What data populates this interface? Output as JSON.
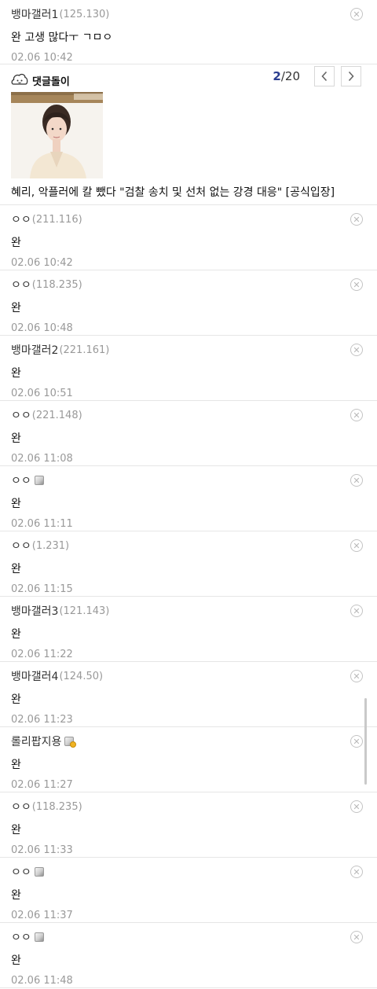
{
  "top_comment": {
    "nick": "뱅마갤러1",
    "ip": "(125.130)",
    "text": "완 고생 많다ㅜ ㄱㅁㅇ",
    "date": "02.06 10:42"
  },
  "promo": {
    "label": "댓글돌이",
    "page_current": "2",
    "page_total": "/20",
    "headline": "혜리, 악플러에 칼 뺐다 \"검찰 송치 및 선처 없는 강경 대응\" [공식입장]"
  },
  "comments": [
    {
      "nick": "ㅇㅇ",
      "ip": "(211.116)",
      "text": "완",
      "date": "02.06 10:42"
    },
    {
      "nick": "ㅇㅇ",
      "ip": "(118.235)",
      "text": "완",
      "date": "02.06 10:48"
    },
    {
      "nick": "뱅마갤러2",
      "ip": "(221.161)",
      "text": "완",
      "date": "02.06 10:51"
    },
    {
      "nick": "ㅇㅇ",
      "ip": "(221.148)",
      "text": "완",
      "date": "02.06 11:08"
    },
    {
      "nick": "ㅇㅇ",
      "ip": "",
      "text": "완",
      "date": "02.06 11:11"
    },
    {
      "nick": "ㅇㅇ",
      "ip": "(1.231)",
      "text": "완",
      "date": "02.06 11:15"
    },
    {
      "nick": "뱅마갤러3",
      "ip": "(121.143)",
      "text": "완",
      "date": "02.06 11:22"
    },
    {
      "nick": "뱅마갤러4",
      "ip": "(124.50)",
      "text": "완",
      "date": "02.06 11:23"
    },
    {
      "nick": "롤리팝지용",
      "ip": "",
      "text": "완",
      "date": "02.06 11:27"
    },
    {
      "nick": "ㅇㅇ",
      "ip": "(118.235)",
      "text": "완",
      "date": "02.06 11:33"
    },
    {
      "nick": "ㅇㅇ",
      "ip": "",
      "text": "완",
      "date": "02.06 11:37"
    },
    {
      "nick": "ㅇㅇ",
      "ip": "",
      "text": "완",
      "date": "02.06 11:48"
    }
  ]
}
